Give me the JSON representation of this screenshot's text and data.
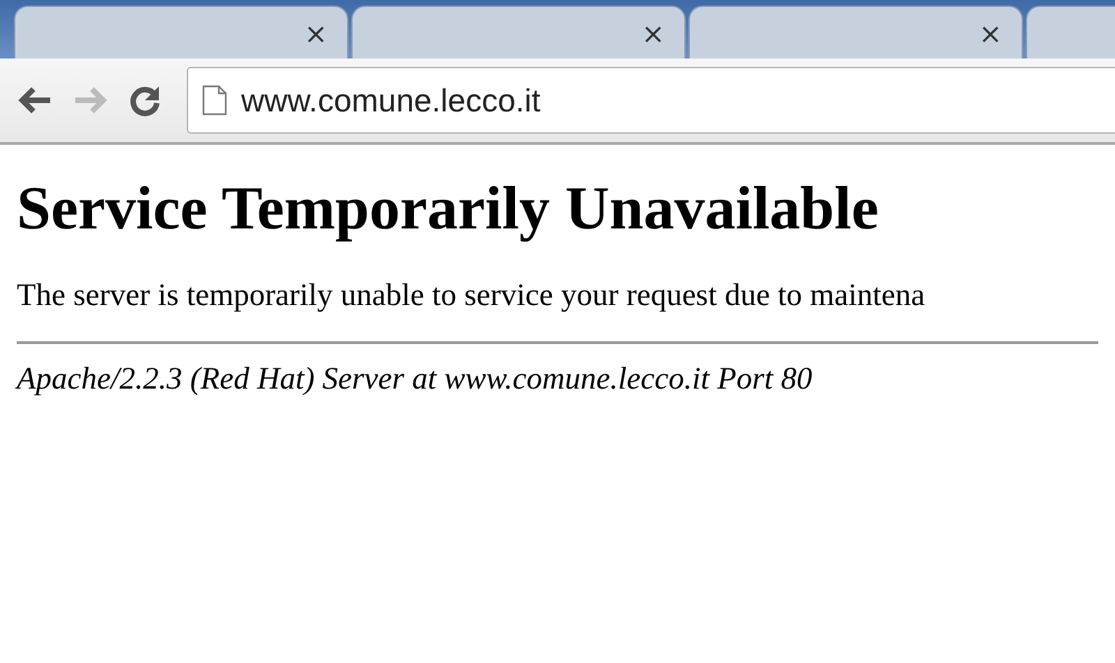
{
  "tabs": [
    {
      "close": "×",
      "selected": false
    },
    {
      "close": "×",
      "selected": false
    },
    {
      "close": "×",
      "selected": false
    },
    {
      "selected": false
    }
  ],
  "toolbar": {
    "buttons": [
      {
        "kind": "back",
        "disabled": false
      },
      {
        "kind": "forward",
        "disabled": true
      },
      {
        "kind": "reload",
        "disabled": false
      }
    ],
    "address": "www.comune.lecco.it"
  },
  "page": {
    "heading": "Service Temporarily Unavailable",
    "message": "The server is temporarily unable to service your request due to maintena",
    "signature": "Apache/2.2.3 (Red Hat) Server at www.comune.lecco.it Port 80"
  }
}
